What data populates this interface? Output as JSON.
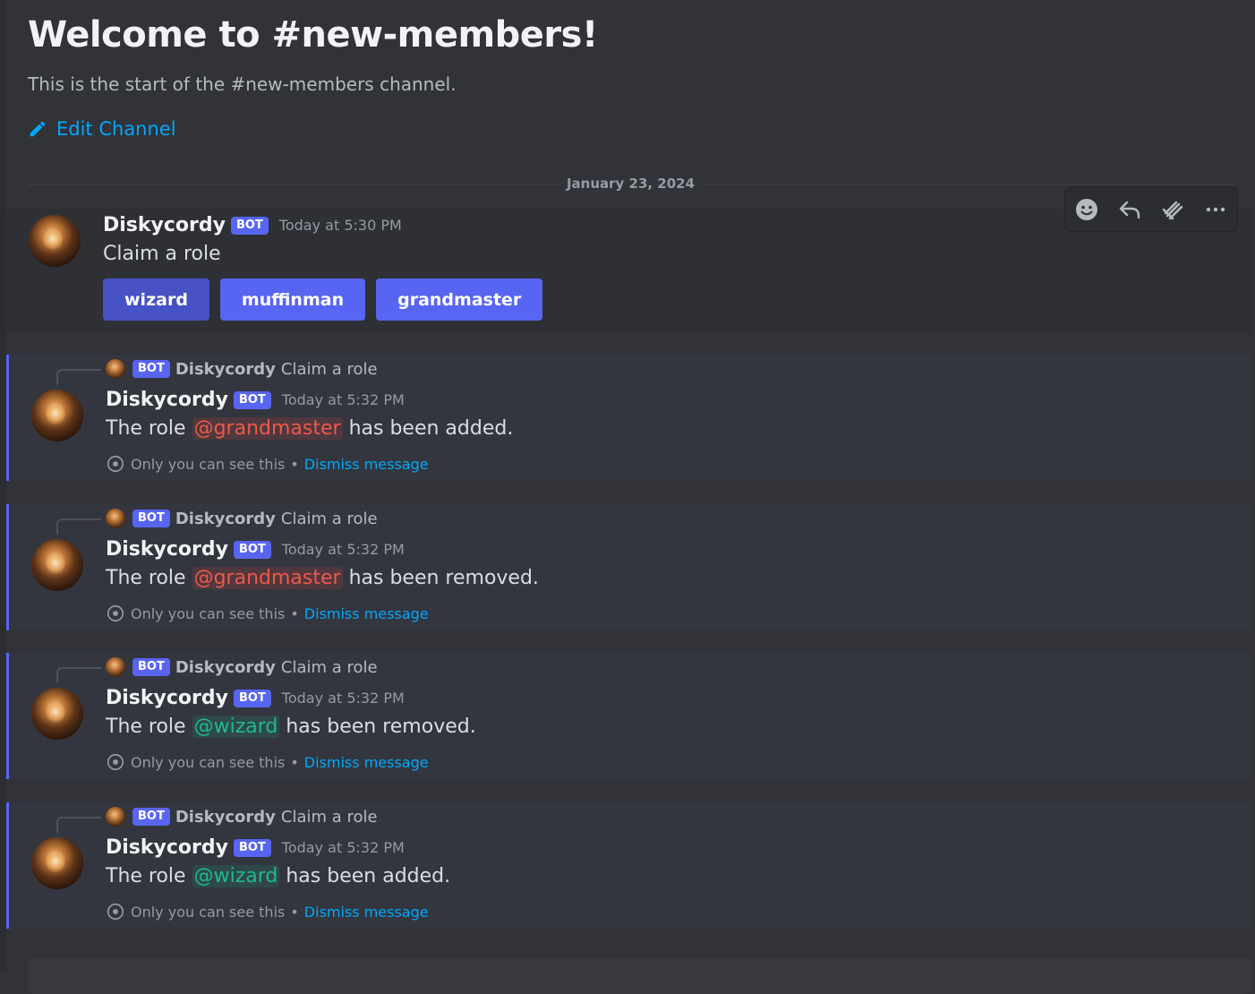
{
  "channel": {
    "welcome_title": "Welcome to #new-members!",
    "start_text": "This is the start of the #new-members channel.",
    "edit_label": "Edit Channel"
  },
  "divider": {
    "date": "January 23, 2024"
  },
  "toolbar": {
    "icons": [
      "add-reaction-icon",
      "reply-icon",
      "forward-icon",
      "more-options-icon"
    ]
  },
  "main_message": {
    "username": "Diskycordy",
    "bot_tag": "BOT",
    "timestamp": "Today at 5:30 PM",
    "content": "Claim a role",
    "buttons": [
      "wizard",
      "muffinman",
      "grandmaster"
    ]
  },
  "ephemeral": [
    {
      "reply_bot": "BOT",
      "reply_user": "Diskycordy",
      "reply_text": "Claim a role",
      "username": "Diskycordy",
      "bot_tag": "BOT",
      "timestamp": "Today at 5:32 PM",
      "prefix": "The role",
      "mention": "@grandmaster",
      "mention_color": "#f0584b",
      "suffix": "has been added.",
      "note": "Only you can see this",
      "sep": "•",
      "dismiss": "Dismiss message"
    },
    {
      "reply_bot": "BOT",
      "reply_user": "Diskycordy",
      "reply_text": "Claim a role",
      "username": "Diskycordy",
      "bot_tag": "BOT",
      "timestamp": "Today at 5:32 PM",
      "prefix": "The role",
      "mention": "@grandmaster",
      "mention_color": "#f0584b",
      "suffix": "has been removed.",
      "note": "Only you can see this",
      "sep": "•",
      "dismiss": "Dismiss message"
    },
    {
      "reply_bot": "BOT",
      "reply_user": "Diskycordy",
      "reply_text": "Claim a role",
      "username": "Diskycordy",
      "bot_tag": "BOT",
      "timestamp": "Today at 5:32 PM",
      "prefix": "The role",
      "mention": "@wizard",
      "mention_color": "#1fb98d",
      "suffix": "has been removed.",
      "note": "Only you can see this",
      "sep": "•",
      "dismiss": "Dismiss message"
    },
    {
      "reply_bot": "BOT",
      "reply_user": "Diskycordy",
      "reply_text": "Claim a role",
      "username": "Diskycordy",
      "bot_tag": "BOT",
      "timestamp": "Today at 5:32 PM",
      "prefix": "The role",
      "mention": "@wizard",
      "mention_color": "#1fb98d",
      "suffix": "has been added.",
      "note": "Only you can see this",
      "sep": "•",
      "dismiss": "Dismiss message"
    }
  ],
  "colors": {
    "background": "#313338",
    "blurple": "#5865f2",
    "link": "#00a8fc"
  }
}
